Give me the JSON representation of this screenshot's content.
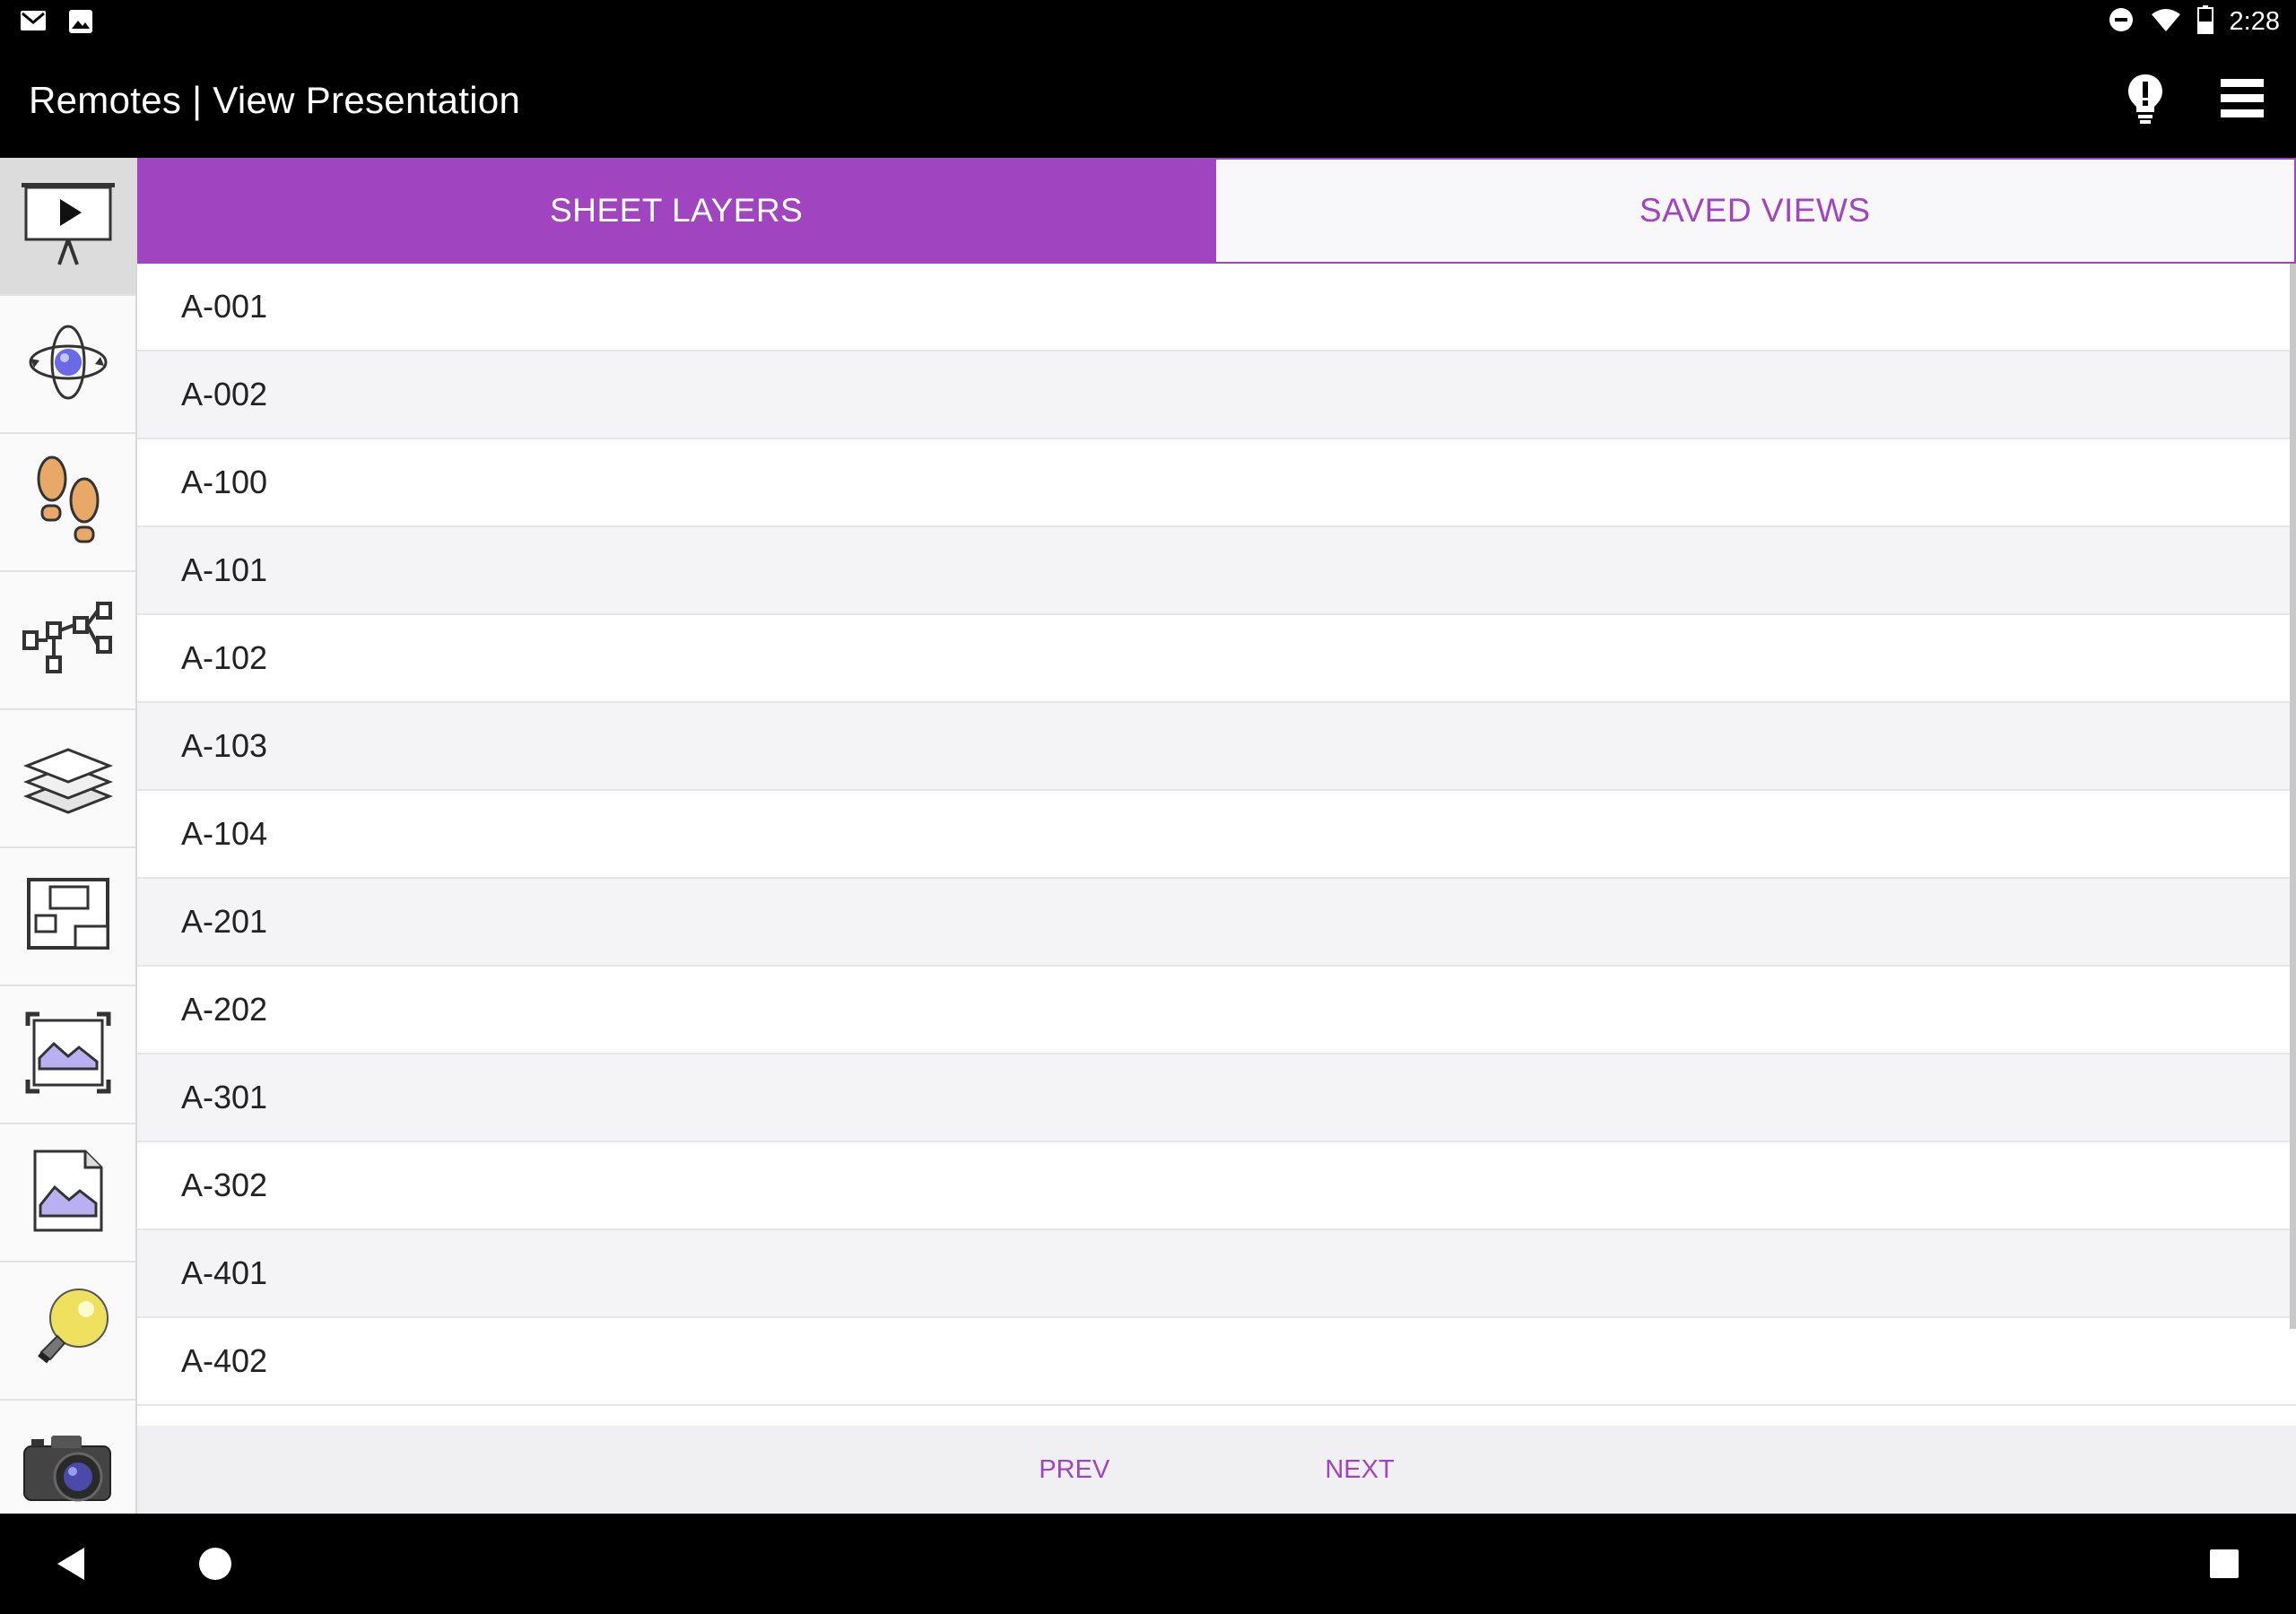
{
  "status_bar": {
    "time": "2:28",
    "left_icons": [
      "gmail-icon",
      "image-icon"
    ],
    "right_icons": [
      "do-not-disturb-icon",
      "wifi-icon",
      "battery-icon"
    ]
  },
  "app_bar": {
    "title": "Remotes | View Presentation",
    "actions": [
      "lightbulb-alert-icon",
      "hamburger-menu-icon"
    ]
  },
  "sidebar": {
    "items": [
      {
        "icon": "presentation-icon",
        "active": true
      },
      {
        "icon": "orbit-icon",
        "active": false
      },
      {
        "icon": "footsteps-icon",
        "active": false
      },
      {
        "icon": "hierarchy-icon",
        "active": false
      },
      {
        "icon": "layers-icon",
        "active": false
      },
      {
        "icon": "floorplan-icon",
        "active": false
      },
      {
        "icon": "fit-image-icon",
        "active": false
      },
      {
        "icon": "image-document-icon",
        "active": false
      },
      {
        "icon": "lightbulb-icon",
        "active": false
      },
      {
        "icon": "camera-icon",
        "active": false
      }
    ]
  },
  "tabs": [
    {
      "label": "SHEET LAYERS",
      "active": true
    },
    {
      "label": "SAVED VIEWS",
      "active": false
    }
  ],
  "rows": [
    "A-001",
    "A-002",
    "A-100",
    "A-101",
    "A-102",
    "A-103",
    "A-104",
    "A-201",
    "A-202",
    "A-301",
    "A-302",
    "A-401",
    "A-402"
  ],
  "pager": {
    "prev": "PREV",
    "next": "NEXT"
  },
  "colors": {
    "accent": "#a044c0",
    "app_bar": "#000000"
  }
}
